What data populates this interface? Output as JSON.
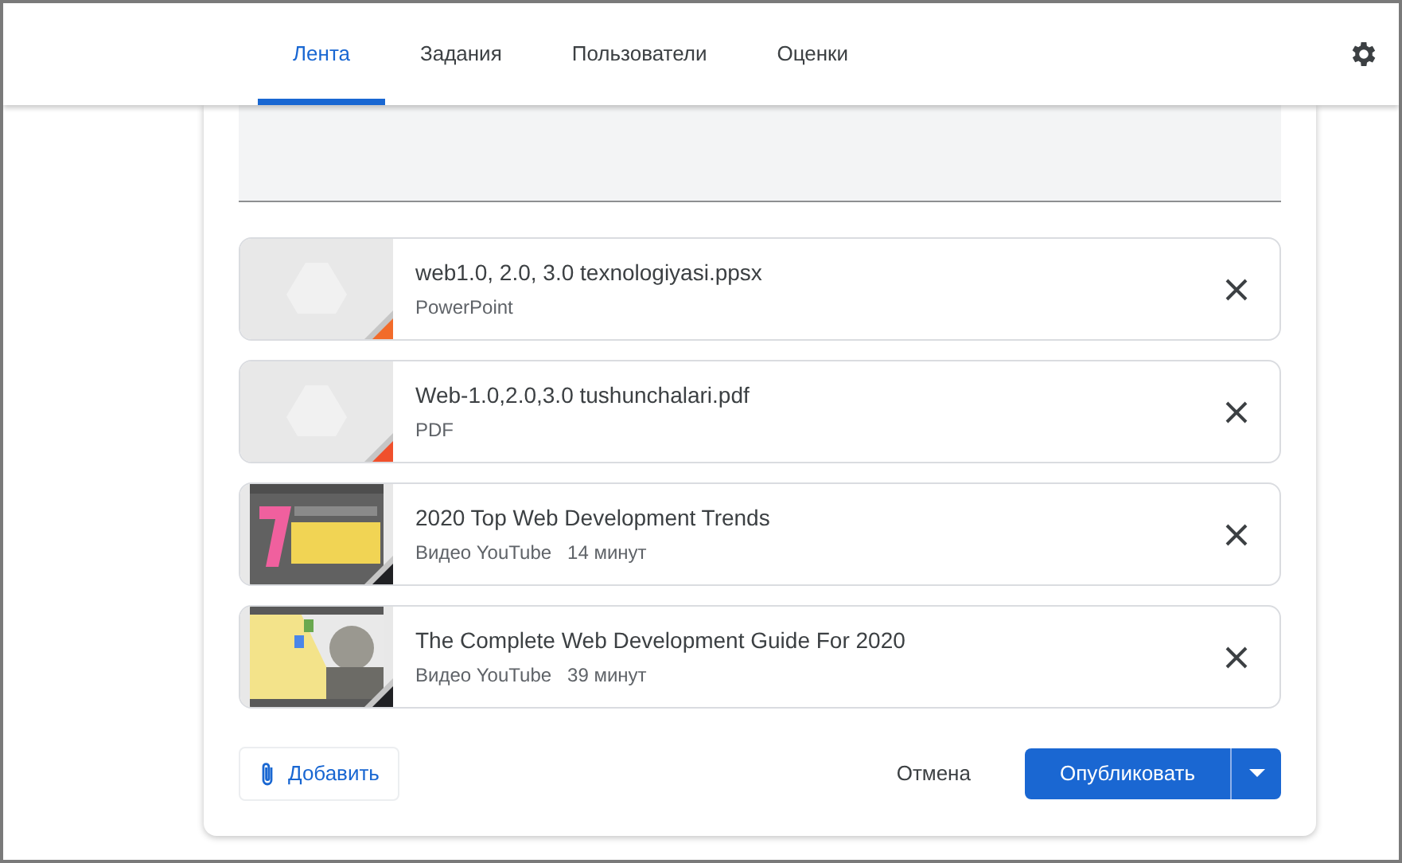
{
  "tabs": [
    {
      "label": "Лента",
      "selected": true
    },
    {
      "label": "Задания",
      "selected": false
    },
    {
      "label": "Пользователи",
      "selected": false
    },
    {
      "label": "Оценки",
      "selected": false
    }
  ],
  "attachments": [
    {
      "kind": "file",
      "title": "web1.0, 2.0, 3.0 texnologiyasi.ppsx",
      "meta": [
        "PowerPoint"
      ],
      "color": "#f26b2a"
    },
    {
      "kind": "file",
      "title": "Web-1.0,2.0,3.0 tushunchalari.pdf",
      "meta": [
        "PDF"
      ],
      "color": "#f0502c"
    },
    {
      "kind": "video",
      "title": "2020 Top Web Development Trends",
      "meta": [
        "Видео YouTube",
        "14 минут"
      ],
      "color": "#202124"
    },
    {
      "kind": "video",
      "title": "The Complete Web Development Guide For 2020",
      "meta": [
        "Видео YouTube",
        "39 минут"
      ],
      "color": "#202124"
    }
  ],
  "footer": {
    "add": "Добавить",
    "cancel": "Отмена",
    "publish": "Опубликовать"
  }
}
